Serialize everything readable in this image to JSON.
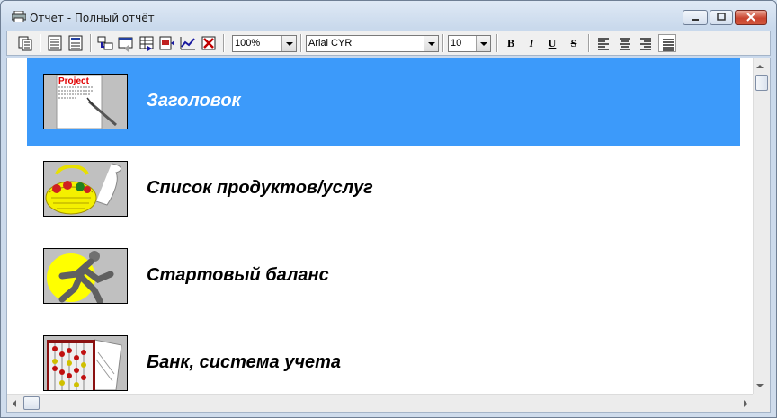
{
  "window": {
    "title": "Отчет - Полный отчёт",
    "title_icon": "printer-icon"
  },
  "toolbar": {
    "buttons": [
      {
        "name": "copy-icon"
      },
      {
        "name": "report-list-icon"
      },
      {
        "name": "report-detail-icon"
      },
      {
        "name": "structure-icon"
      },
      {
        "name": "export-icon"
      },
      {
        "name": "table-icon"
      },
      {
        "name": "sheet-export-icon"
      },
      {
        "name": "chart-icon"
      },
      {
        "name": "delete-icon"
      }
    ],
    "zoom": {
      "value": "100%"
    },
    "font": {
      "value": "Arial CYR"
    },
    "size": {
      "value": "10"
    },
    "format": {
      "bold": "B",
      "italic": "I",
      "underline": "U",
      "strike": "S"
    },
    "align": [
      "align-left-icon",
      "align-center-icon",
      "align-right-icon",
      "align-justify-icon"
    ]
  },
  "report": {
    "sections": [
      {
        "label": "Заголовок",
        "icon": "project-document-icon",
        "selected": true
      },
      {
        "label": "Список продуктов/услуг",
        "icon": "fruit-basket-icon",
        "selected": false
      },
      {
        "label": "Стартовый баланс",
        "icon": "runner-icon",
        "selected": false
      },
      {
        "label": "Банк, система учета",
        "icon": "abacus-icon",
        "selected": false
      }
    ],
    "thumb_texts": {
      "project": "Project"
    }
  },
  "colors": {
    "selection": "#3c9afa",
    "background": "#ffffff",
    "label_text": "#000000",
    "selected_text": "#ffffff"
  }
}
